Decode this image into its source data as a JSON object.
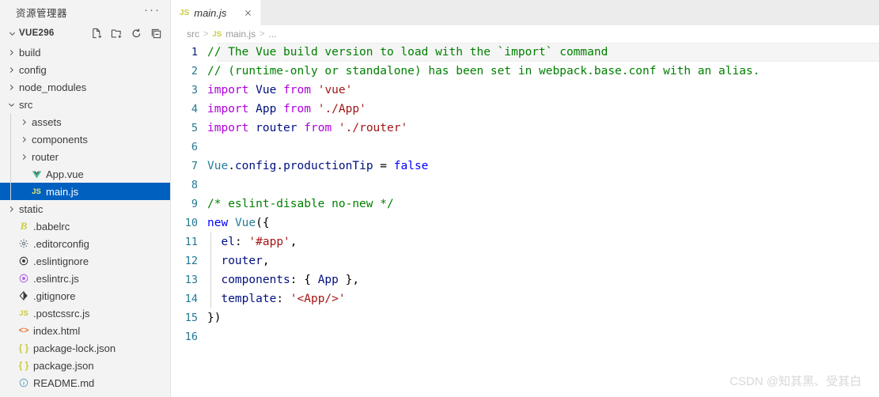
{
  "sidebar": {
    "title": "资源管理器",
    "more_label": "···",
    "root": {
      "label": "VUE296",
      "expanded": true
    },
    "actions": [
      {
        "name": "new-file-icon",
        "tooltip": "新建文件"
      },
      {
        "name": "new-folder-icon",
        "tooltip": "新建文件夹"
      },
      {
        "name": "refresh-icon",
        "tooltip": "刷新资源管理器"
      },
      {
        "name": "collapse-all-icon",
        "tooltip": "在资源管理器中折叠文件夹"
      }
    ],
    "items": [
      {
        "label": "build",
        "type": "folder",
        "expanded": false,
        "depth": 1,
        "icon": "chevron-right-icon",
        "selected": false
      },
      {
        "label": "config",
        "type": "folder",
        "expanded": false,
        "depth": 1,
        "icon": "chevron-right-icon",
        "selected": false
      },
      {
        "label": "node_modules",
        "type": "folder",
        "expanded": false,
        "depth": 1,
        "icon": "chevron-right-icon",
        "selected": false
      },
      {
        "label": "src",
        "type": "folder",
        "expanded": true,
        "depth": 1,
        "icon": "chevron-down-icon",
        "selected": false
      },
      {
        "label": "assets",
        "type": "folder",
        "expanded": false,
        "depth": 2,
        "icon": "chevron-right-icon",
        "selected": false
      },
      {
        "label": "components",
        "type": "folder",
        "expanded": false,
        "depth": 2,
        "icon": "chevron-right-icon",
        "selected": false
      },
      {
        "label": "router",
        "type": "folder",
        "expanded": false,
        "depth": 2,
        "icon": "chevron-right-icon",
        "selected": false
      },
      {
        "label": "App.vue",
        "type": "file",
        "depth": 2,
        "icon": "vue-file-icon",
        "selected": false
      },
      {
        "label": "main.js",
        "type": "file",
        "depth": 2,
        "icon": "js-file-icon",
        "selected": true
      },
      {
        "label": "static",
        "type": "folder",
        "expanded": false,
        "depth": 1,
        "icon": "chevron-right-icon",
        "selected": false
      },
      {
        "label": ".babelrc",
        "type": "file",
        "depth": 1,
        "icon": "babel-file-icon",
        "selected": false
      },
      {
        "label": ".editorconfig",
        "type": "file",
        "depth": 1,
        "icon": "gear-file-icon",
        "selected": false
      },
      {
        "label": ".eslintignore",
        "type": "file",
        "depth": 1,
        "icon": "eslintignore-file-icon",
        "selected": false
      },
      {
        "label": ".eslintrc.js",
        "type": "file",
        "depth": 1,
        "icon": "eslintrc-file-icon",
        "selected": false
      },
      {
        "label": ".gitignore",
        "type": "file",
        "depth": 1,
        "icon": "git-file-icon",
        "selected": false
      },
      {
        "label": ".postcssrc.js",
        "type": "file",
        "depth": 1,
        "icon": "js-file-icon",
        "selected": false
      },
      {
        "label": "index.html",
        "type": "file",
        "depth": 1,
        "icon": "html-file-icon",
        "selected": false
      },
      {
        "label": "package-lock.json",
        "type": "file",
        "depth": 1,
        "icon": "json-file-icon",
        "selected": false
      },
      {
        "label": "package.json",
        "type": "file",
        "depth": 1,
        "icon": "json-file-icon",
        "selected": false
      },
      {
        "label": "README.md",
        "type": "file",
        "depth": 1,
        "icon": "markdown-file-icon",
        "selected": false
      }
    ]
  },
  "editor": {
    "tabs": [
      {
        "label": "main.js",
        "icon": "js-file-icon",
        "preview": true,
        "active": true,
        "close_label": "×"
      }
    ],
    "breadcrumb": {
      "separator": ">",
      "items": [
        {
          "label": "src",
          "icon": ""
        },
        {
          "label": "main.js",
          "icon": "js-file-icon"
        },
        {
          "label": "...",
          "icon": ""
        }
      ]
    },
    "lines": [
      {
        "number": "1",
        "active": true,
        "indent_guides": 0,
        "tokens": [
          {
            "text": "// The Vue build version to load with the `import` command",
            "cls": "t-comment"
          }
        ]
      },
      {
        "number": "2",
        "active": false,
        "indent_guides": 0,
        "tokens": [
          {
            "text": "// (runtime-only or standalone) has been set in webpack.base.conf with an alias.",
            "cls": "t-comment"
          }
        ]
      },
      {
        "number": "3",
        "active": false,
        "indent_guides": 0,
        "tokens": [
          {
            "text": "import",
            "cls": "t-keyword"
          },
          {
            "text": " ",
            "cls": "t-plain"
          },
          {
            "text": "Vue",
            "cls": "t-ident"
          },
          {
            "text": " ",
            "cls": "t-plain"
          },
          {
            "text": "from",
            "cls": "t-keyword"
          },
          {
            "text": " ",
            "cls": "t-plain"
          },
          {
            "text": "'vue'",
            "cls": "t-string"
          }
        ]
      },
      {
        "number": "4",
        "active": false,
        "indent_guides": 0,
        "tokens": [
          {
            "text": "import",
            "cls": "t-keyword"
          },
          {
            "text": " ",
            "cls": "t-plain"
          },
          {
            "text": "App",
            "cls": "t-ident"
          },
          {
            "text": " ",
            "cls": "t-plain"
          },
          {
            "text": "from",
            "cls": "t-keyword"
          },
          {
            "text": " ",
            "cls": "t-plain"
          },
          {
            "text": "'./App'",
            "cls": "t-string"
          }
        ]
      },
      {
        "number": "5",
        "active": false,
        "indent_guides": 0,
        "tokens": [
          {
            "text": "import",
            "cls": "t-keyword"
          },
          {
            "text": " ",
            "cls": "t-plain"
          },
          {
            "text": "router",
            "cls": "t-ident"
          },
          {
            "text": " ",
            "cls": "t-plain"
          },
          {
            "text": "from",
            "cls": "t-keyword"
          },
          {
            "text": " ",
            "cls": "t-plain"
          },
          {
            "text": "'./router'",
            "cls": "t-string"
          }
        ]
      },
      {
        "number": "6",
        "active": false,
        "indent_guides": 0,
        "tokens": []
      },
      {
        "number": "7",
        "active": false,
        "indent_guides": 0,
        "tokens": [
          {
            "text": "Vue",
            "cls": "t-class"
          },
          {
            "text": ".",
            "cls": "t-plain"
          },
          {
            "text": "config",
            "cls": "t-prop"
          },
          {
            "text": ".",
            "cls": "t-plain"
          },
          {
            "text": "productionTip",
            "cls": "t-prop"
          },
          {
            "text": " = ",
            "cls": "t-plain"
          },
          {
            "text": "false",
            "cls": "t-ctrl"
          }
        ]
      },
      {
        "number": "8",
        "active": false,
        "indent_guides": 0,
        "tokens": []
      },
      {
        "number": "9",
        "active": false,
        "indent_guides": 0,
        "tokens": [
          {
            "text": "/* eslint-disable no-new */",
            "cls": "t-comment"
          }
        ]
      },
      {
        "number": "10",
        "active": false,
        "indent_guides": 0,
        "tokens": [
          {
            "text": "new",
            "cls": "t-ctrl"
          },
          {
            "text": " ",
            "cls": "t-plain"
          },
          {
            "text": "Vue",
            "cls": "t-class"
          },
          {
            "text": "({",
            "cls": "t-plain"
          }
        ]
      },
      {
        "number": "11",
        "active": false,
        "indent_guides": 1,
        "tokens": [
          {
            "text": "  ",
            "cls": "t-plain"
          },
          {
            "text": "el",
            "cls": "t-prop"
          },
          {
            "text": ": ",
            "cls": "t-plain"
          },
          {
            "text": "'#app'",
            "cls": "t-string"
          },
          {
            "text": ",",
            "cls": "t-plain"
          }
        ]
      },
      {
        "number": "12",
        "active": false,
        "indent_guides": 1,
        "tokens": [
          {
            "text": "  ",
            "cls": "t-plain"
          },
          {
            "text": "router",
            "cls": "t-prop"
          },
          {
            "text": ",",
            "cls": "t-plain"
          }
        ]
      },
      {
        "number": "13",
        "active": false,
        "indent_guides": 1,
        "tokens": [
          {
            "text": "  ",
            "cls": "t-plain"
          },
          {
            "text": "components",
            "cls": "t-prop"
          },
          {
            "text": ": { ",
            "cls": "t-plain"
          },
          {
            "text": "App",
            "cls": "t-ident"
          },
          {
            "text": " },",
            "cls": "t-plain"
          }
        ]
      },
      {
        "number": "14",
        "active": false,
        "indent_guides": 1,
        "tokens": [
          {
            "text": "  ",
            "cls": "t-plain"
          },
          {
            "text": "template",
            "cls": "t-prop"
          },
          {
            "text": ": ",
            "cls": "t-plain"
          },
          {
            "text": "'<App/>'",
            "cls": "t-string"
          }
        ]
      },
      {
        "number": "15",
        "active": false,
        "indent_guides": 0,
        "tokens": [
          {
            "text": "})",
            "cls": "t-plain"
          }
        ]
      },
      {
        "number": "16",
        "active": false,
        "indent_guides": 0,
        "tokens": []
      }
    ]
  },
  "watermark": "CSDN @知其黑、受其白",
  "colors": {
    "selection_blue": "#0060c0",
    "sidebar_bg": "#f3f3f3",
    "editor_bg": "#ffffff",
    "tabbar_bg": "#ececec",
    "line_number": "#237893",
    "comment": "#008000",
    "keyword": "#af00db",
    "control": "#0000ff",
    "identifier": "#001080",
    "string": "#a31515",
    "class": "#267f99"
  }
}
